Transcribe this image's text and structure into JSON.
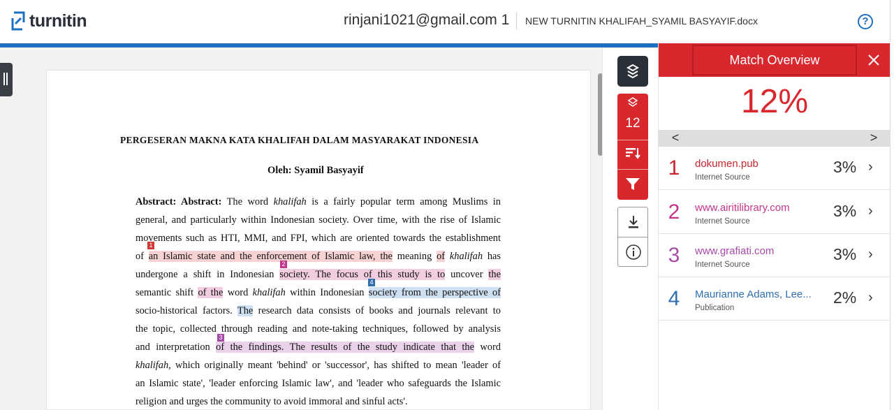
{
  "header": {
    "logo_text": "turnitin",
    "user": "rinjani1021@gmail.com 1",
    "filename": "NEW TURNITIN KHALIFAH_SYAMIL BASYAYIF.docx",
    "help_label": "?"
  },
  "document": {
    "title": "PERGESERAN MAKNA KATA KHALIFAH DALAM MASYARAKAT INDONESIA",
    "author": "Oleh: Syamil Basyayif",
    "lines": {
      "l1_bold": "Abstract: Abstract:",
      "l1_a": " The word ",
      "l1_i": "khalifah",
      "l1_b": " is a fairly popular term among Muslims in",
      "l2": "general, and particularly within Indonesian society. Over time, with the rise of Islamic",
      "l3": "movements such as HTI, MMI, and FPI, which are oriented towards the establishment",
      "l4_a": "of ",
      "l4_hl": "an Islamic state and the enforcement of Islamic law, the",
      "l4_b": " meaning ",
      "l4_hl2": "of",
      "l4_i": " khalifah",
      "l4_c": " has",
      "l5_a": "undergone a shift in Indonesian ",
      "l5_hl": "society. The focus of this study is to",
      "l5_b": " uncover ",
      "l5_hl2": "the",
      "l6_a": "semantic shift ",
      "l6_hl": "of the",
      "l6_b": " word ",
      "l6_i": "khalifah",
      "l6_c": " within Indonesian ",
      "l6_hl2": "society from the perspective of",
      "l7_a": "socio-historical factors. ",
      "l7_hl": "The",
      "l7_b": " research data consists of books and journals relevant to",
      "l8": "the topic, collected through reading and note-taking techniques, followed by analysis",
      "l9_a": "and interpretation ",
      "l9_hl": "of the findings. The results of the study indicate that the",
      "l9_b": " word",
      "l10_i": "khalifah",
      "l10_a": ", which originally meant 'behind' or 'successor', has shifted to mean 'leader of",
      "l11": "an Islamic state', 'leader enforcing Islamic law', and 'leader who safeguards the Islamic",
      "l12": "religion and urges the community to avoid immoral and sinful acts'."
    },
    "markers": [
      "1",
      "2",
      "3",
      "4"
    ]
  },
  "toolbar": {
    "match_count": "12"
  },
  "panel": {
    "title": "Match Overview",
    "overall_percent": "12%",
    "prev": "<",
    "next": ">",
    "matches": [
      {
        "num": "1",
        "source": "dokumen.pub",
        "type": "Internet Source",
        "percent": "3%",
        "color": "#c8242b"
      },
      {
        "num": "2",
        "source": "www.airitilibrary.com",
        "type": "Internet Source",
        "percent": "3%",
        "color": "#c2368a"
      },
      {
        "num": "3",
        "source": "www.grafiati.com",
        "type": "Internet Source",
        "percent": "3%",
        "color": "#a84aa8"
      },
      {
        "num": "4",
        "source": "Maurianne Adams, Lee...",
        "type": "Publication",
        "percent": "2%",
        "color": "#2f6fb0"
      }
    ]
  },
  "colors": {
    "brand_red": "#d9272e",
    "brand_blue": "#1d6fbf"
  }
}
